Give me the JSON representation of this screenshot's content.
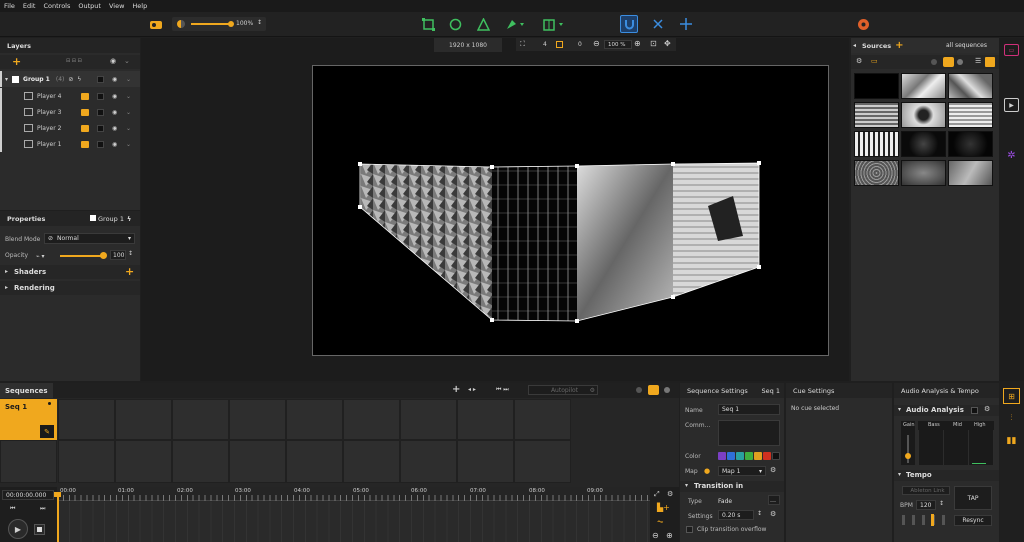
{
  "menu": [
    "File",
    "Edit",
    "Controls",
    "Output",
    "View",
    "Help"
  ],
  "toolbar": {
    "zoom": "100%",
    "canvas_size": "1920 x 1080",
    "view_zoom": "100 %",
    "count_a": "4",
    "count_b": "0"
  },
  "layers": {
    "title": "Layers",
    "group": "Group 1",
    "group_count": "(4)",
    "items": [
      "Player 4",
      "Player 3",
      "Player 2",
      "Player 1"
    ]
  },
  "properties": {
    "title": "Properties",
    "target": "Group 1",
    "blend_label": "Blend Mode",
    "blend_value": "Normal",
    "opacity_label": "Opacity",
    "opacity_value": "100",
    "opacity_level": 1.0,
    "shaders": "Shaders",
    "rendering": "Rendering"
  },
  "sources": {
    "title": "Sources",
    "filter": "all sequences"
  },
  "sequences": {
    "tab": "Sequences",
    "seq_name": "Seq 1",
    "autopilot": "Autopilot",
    "timecode": "00:00:00.000",
    "ticks": [
      "00:00",
      "01:00",
      "02:00",
      "03:00",
      "04:00",
      "05:00",
      "06:00",
      "07:00",
      "08:00",
      "09:00"
    ]
  },
  "seq_settings": {
    "title": "Sequence Settings",
    "seq": "Seq 1",
    "name_label": "Name",
    "name_value": "Seq 1",
    "comment_label": "Comm...",
    "color_label": "Color",
    "map_label": "Map",
    "map_value": "Map 1",
    "transition": "Transition in",
    "type_label": "Type",
    "type_value": "Fade",
    "settings_label": "Settings",
    "settings_value": "0.20 s",
    "clip_overflow": "Clip transition overflow",
    "colors": [
      "#7b3fc4",
      "#2f6fd8",
      "#2aa0a0",
      "#3fae3f",
      "#e0a020",
      "#d03020",
      "#111111",
      "#6e6e3a"
    ]
  },
  "cue": {
    "title": "Cue Settings",
    "empty": "No cue selected"
  },
  "audio": {
    "title": "Audio Analysis & Tempo",
    "section": "Audio Analysis",
    "gain": "Gain",
    "bass": "Bass",
    "mid": "Mid",
    "high": "High",
    "tempo": "Tempo",
    "ableton": "Ableton Link",
    "bpm_label": "BPM",
    "bpm_value": "120",
    "tap": "TAP",
    "resync": "Resync"
  },
  "colors": {
    "accent": "#f0a81e",
    "green": "#3fbf5f",
    "blue": "#3b8de0"
  }
}
